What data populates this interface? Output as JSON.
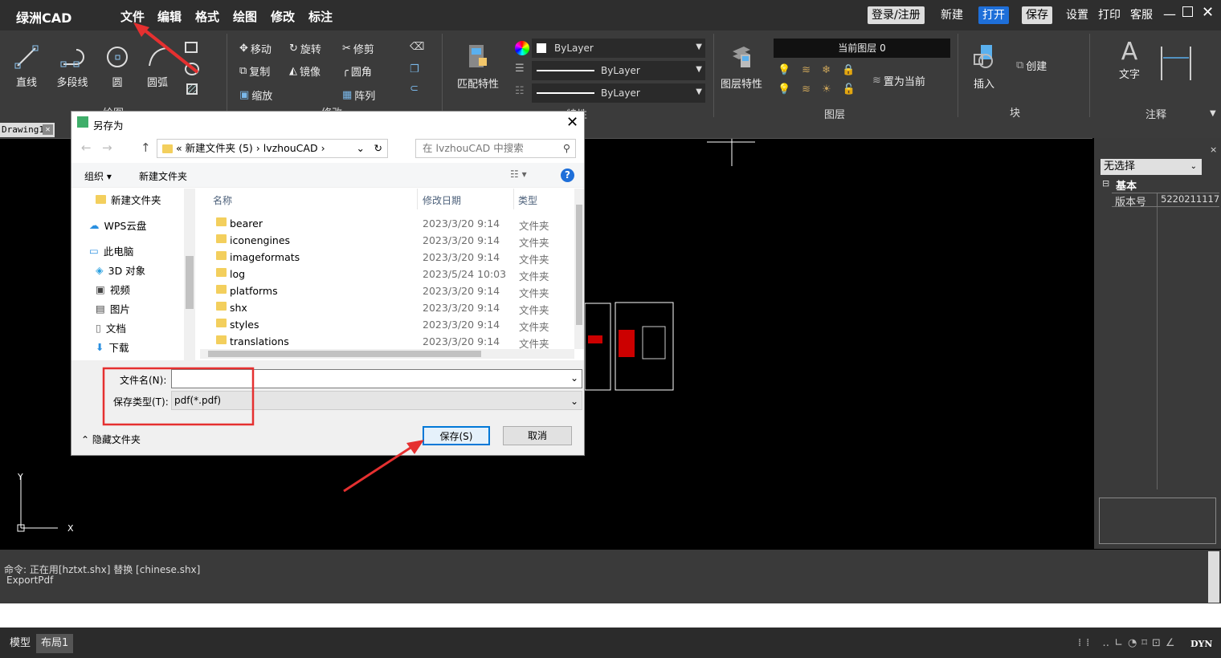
{
  "app": {
    "title": "绿洲CAD",
    "menu": [
      "文件",
      "编辑",
      "格式",
      "绘图",
      "修改",
      "标注"
    ],
    "top_buttons": [
      "登录/注册",
      "新建",
      "打开",
      "保存",
      "设置",
      "打印",
      "客服"
    ],
    "accent": "#1e6fd9"
  },
  "ribbon": {
    "draw": {
      "items": [
        "直线",
        "多段线",
        "圆",
        "圆弧"
      ],
      "group": "绘图"
    },
    "modify": {
      "items": [
        "移动",
        "旋转",
        "修剪",
        "复制",
        "镜像",
        "圆角",
        "缩放",
        "阵列"
      ],
      "group": "修改"
    },
    "props": {
      "match": "匹配特性",
      "color": "ByLayer",
      "linetype": "ByLayer",
      "lineweight": "ByLayer",
      "group": "特性"
    },
    "layer": {
      "props": "图层特性",
      "current": "当前图层 0",
      "set_current": "置为当前",
      "group": "图层"
    },
    "block": {
      "insert": "插入",
      "create": "创建",
      "group": "块"
    },
    "annot": {
      "text": "文字",
      "group": "注释"
    }
  },
  "doc_tab": "Drawing1",
  "right_panel": {
    "select": "无选择",
    "section": "基本",
    "prop_name": "版本号",
    "prop_value": "5220211117"
  },
  "command": {
    "line1": "命令: 正在用[hztxt.shx] 替换 [chinese.shx]",
    "line2": "ExportPdf"
  },
  "status": {
    "tabs": [
      "模型",
      "布局1"
    ],
    "dyn": "DYN"
  },
  "dialog": {
    "title": "另存为",
    "path": [
      "新建文件夹 (5)",
      "lvzhouCAD"
    ],
    "search_placeholder": "在 lvzhouCAD 中搜索",
    "organize": "组织 ▾",
    "new_folder": "新建文件夹",
    "nav": [
      "新建文件夹",
      "WPS云盘",
      "此电脑",
      "3D 对象",
      "视频",
      "图片",
      "文档",
      "下载"
    ],
    "columns": [
      "名称",
      "修改日期",
      "类型"
    ],
    "files": [
      {
        "name": "bearer",
        "date": "2023/3/20 9:14",
        "type": "文件夹"
      },
      {
        "name": "iconengines",
        "date": "2023/3/20 9:14",
        "type": "文件夹"
      },
      {
        "name": "imageformats",
        "date": "2023/3/20 9:14",
        "type": "文件夹"
      },
      {
        "name": "log",
        "date": "2023/5/24 10:03",
        "type": "文件夹"
      },
      {
        "name": "platforms",
        "date": "2023/3/20 9:14",
        "type": "文件夹"
      },
      {
        "name": "shx",
        "date": "2023/3/20 9:14",
        "type": "文件夹"
      },
      {
        "name": "styles",
        "date": "2023/3/20 9:14",
        "type": "文件夹"
      },
      {
        "name": "translations",
        "date": "2023/3/20 9:14",
        "type": "文件夹"
      }
    ],
    "filename_label": "文件名(N):",
    "filename_value": "",
    "filetype_label": "保存类型(T):",
    "filetype_value": "pdf(*.pdf)",
    "hide_folders": "隐藏文件夹",
    "save": "保存(S)",
    "cancel": "取消"
  }
}
